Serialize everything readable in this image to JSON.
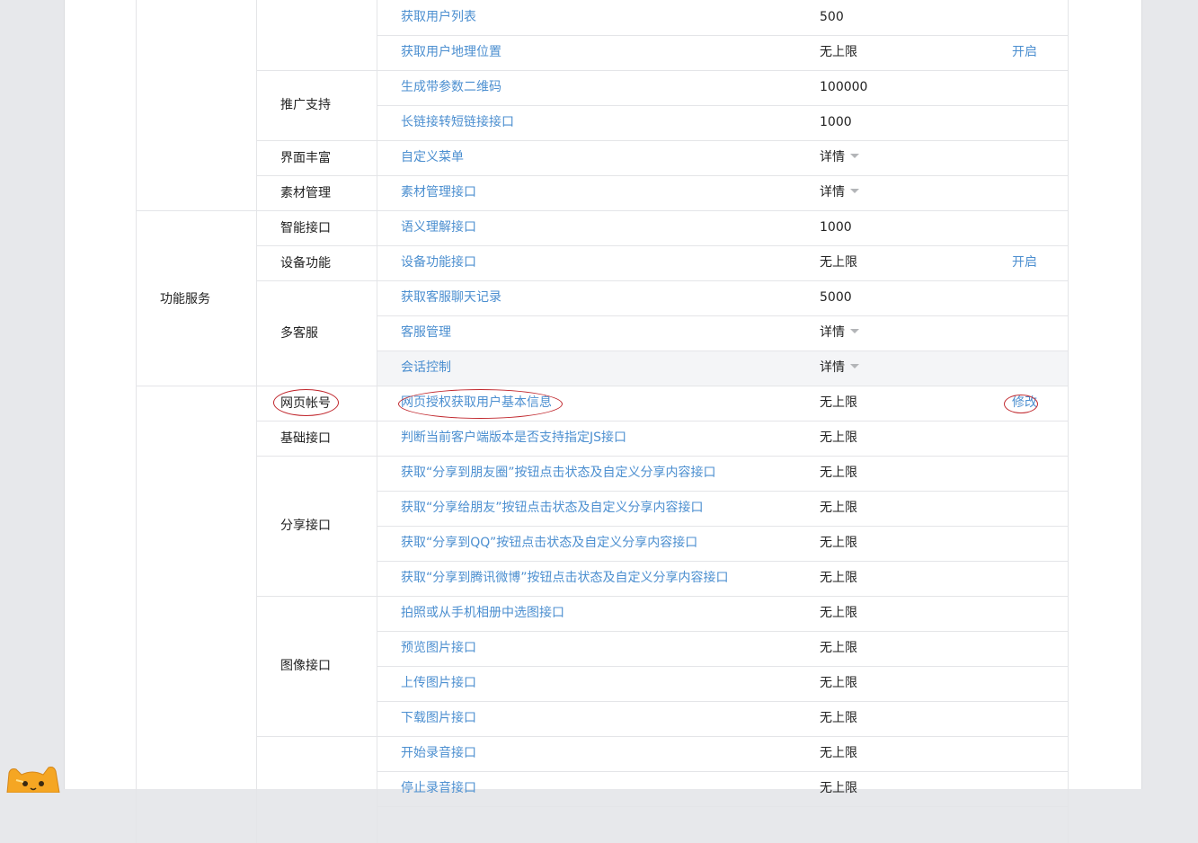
{
  "table": {
    "categories": [
      {
        "label": ""
      },
      {
        "label": "功能服务"
      },
      {
        "label": ""
      }
    ],
    "subcategories": [
      {
        "label": ""
      },
      {
        "label": "推广支持"
      },
      {
        "label": "界面丰富"
      },
      {
        "label": "素材管理"
      },
      {
        "label": "智能接口"
      },
      {
        "label": "设备功能"
      },
      {
        "label": "多客服"
      },
      {
        "label": "网页帐号"
      },
      {
        "label": "基础接口"
      },
      {
        "label": "分享接口"
      },
      {
        "label": "图像接口"
      },
      {
        "label": ""
      }
    ],
    "rows": [
      {
        "name": "获取用户列表",
        "quota": "500",
        "op": ""
      },
      {
        "name": "获取用户地理位置",
        "quota": "无上限",
        "op": "开启"
      },
      {
        "name": "生成带参数二维码",
        "quota": "100000",
        "op": ""
      },
      {
        "name": "长链接转短链接接口",
        "quota": "1000",
        "op": ""
      },
      {
        "name": "自定义菜单",
        "quota": "详情",
        "op": ""
      },
      {
        "name": "素材管理接口",
        "quota": "详情",
        "op": ""
      },
      {
        "name": "语义理解接口",
        "quota": "1000",
        "op": ""
      },
      {
        "name": "设备功能接口",
        "quota": "无上限",
        "op": "开启"
      },
      {
        "name": "获取客服聊天记录",
        "quota": "5000",
        "op": ""
      },
      {
        "name": "客服管理",
        "quota": "详情",
        "op": ""
      },
      {
        "name": "会话控制",
        "quota": "详情",
        "op": ""
      },
      {
        "name": "网页授权获取用户基本信息",
        "quota": "无上限",
        "op": "修改"
      },
      {
        "name": "判断当前客户端版本是否支持指定JS接口",
        "quota": "无上限",
        "op": ""
      },
      {
        "name": "获取“分享到朋友圈”按钮点击状态及自定义分享内容接口",
        "quota": "无上限",
        "op": ""
      },
      {
        "name": "获取“分享给朋友”按钮点击状态及自定义分享内容接口",
        "quota": "无上限",
        "op": ""
      },
      {
        "name": "获取“分享到QQ”按钮点击状态及自定义分享内容接口",
        "quota": "无上限",
        "op": ""
      },
      {
        "name": "获取“分享到腾讯微博”按钮点击状态及自定义分享内容接口",
        "quota": "无上限",
        "op": ""
      },
      {
        "name": "拍照或从手机相册中选图接口",
        "quota": "无上限",
        "op": ""
      },
      {
        "name": "预览图片接口",
        "quota": "无上限",
        "op": ""
      },
      {
        "name": "上传图片接口",
        "quota": "无上限",
        "op": ""
      },
      {
        "name": "下载图片接口",
        "quota": "无上限",
        "op": ""
      },
      {
        "name": "开始录音接口",
        "quota": "无上限",
        "op": ""
      },
      {
        "name": "停止录音接口",
        "quota": "无上限",
        "op": ""
      }
    ]
  },
  "colors": {
    "link": "#4c8fd0",
    "annotation": "#c0262c",
    "background": "#e7e8eb",
    "border": "#e4e5e8",
    "hover_row": "#f4f5f7"
  },
  "icons": {
    "detail_caret": "caret-down-icon",
    "mascot": "cat-mascot-icon"
  }
}
